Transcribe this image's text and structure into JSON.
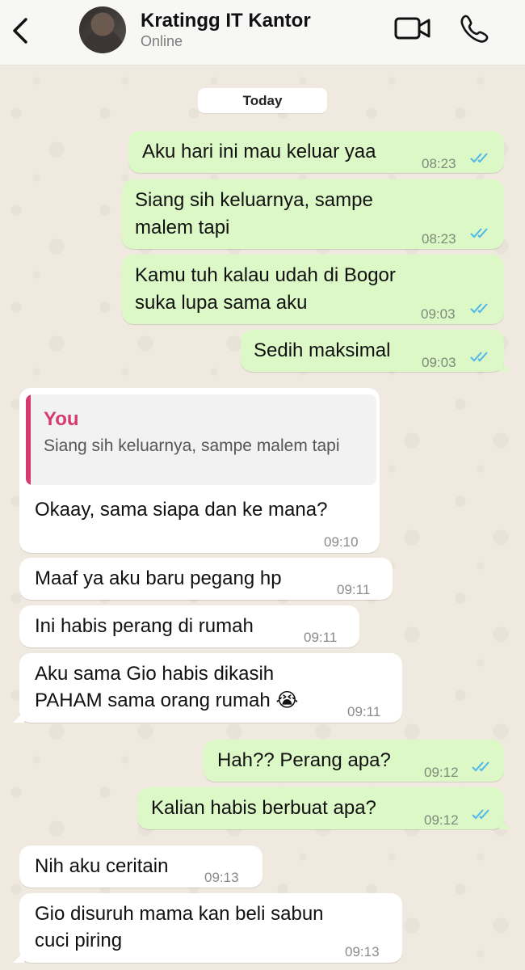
{
  "header": {
    "contact_name": "Kratingg IT Kantor",
    "status": "Online"
  },
  "chat": {
    "date_label": "Today",
    "messages": [
      {
        "direction": "outgoing",
        "lines": [
          "Aku hari ini mau keluar yaa"
        ],
        "time": "08:23",
        "read": true
      },
      {
        "direction": "outgoing",
        "lines": [
          "Siang sih keluarnya, sampe",
          "malem tapi"
        ],
        "time": "08:23",
        "read": true
      },
      {
        "direction": "outgoing",
        "lines": [
          "Kamu tuh kalau udah di Bogor",
          "suka lupa sama aku"
        ],
        "time": "09:03",
        "read": true
      },
      {
        "direction": "outgoing",
        "lines": [
          "Sedih maksimal"
        ],
        "time": "09:03",
        "read": true
      },
      {
        "direction": "incoming",
        "reply_to": {
          "author": "You",
          "text": "Siang sih keluarnya, sampe malem tapi"
        },
        "lines": [
          "Okaay, sama siapa dan ke mana?"
        ],
        "time": "09:10"
      },
      {
        "direction": "incoming",
        "lines": [
          "Maaf ya aku baru pegang hp"
        ],
        "time": "09:11"
      },
      {
        "direction": "incoming",
        "lines": [
          "Ini habis perang di rumah"
        ],
        "time": "09:11"
      },
      {
        "direction": "incoming",
        "lines": [
          "Aku sama Gio habis dikasih",
          "PAHAM sama orang rumah 😭"
        ],
        "time": "09:11"
      },
      {
        "direction": "outgoing",
        "lines": [
          "Hah?? Perang apa?"
        ],
        "time": "09:12",
        "read": true
      },
      {
        "direction": "outgoing",
        "lines": [
          "Kalian habis berbuat apa?"
        ],
        "time": "09:12",
        "read": true
      },
      {
        "direction": "incoming",
        "lines": [
          "Nih aku ceritain"
        ],
        "time": "09:13"
      },
      {
        "direction": "incoming",
        "lines": [
          "Gio disuruh mama kan beli sabun",
          "cuci piring"
        ],
        "time": "09:13"
      }
    ]
  },
  "colors": {
    "outgoing_bubble": "#dcf8c6",
    "incoming_bubble": "#ffffff",
    "read_ticks": "#4fb6ec",
    "reply_accent": "#d63a6e"
  },
  "icons": {
    "back": "chevron-left-icon",
    "video": "video-camera-icon",
    "call": "phone-icon",
    "read": "double-check-icon"
  }
}
